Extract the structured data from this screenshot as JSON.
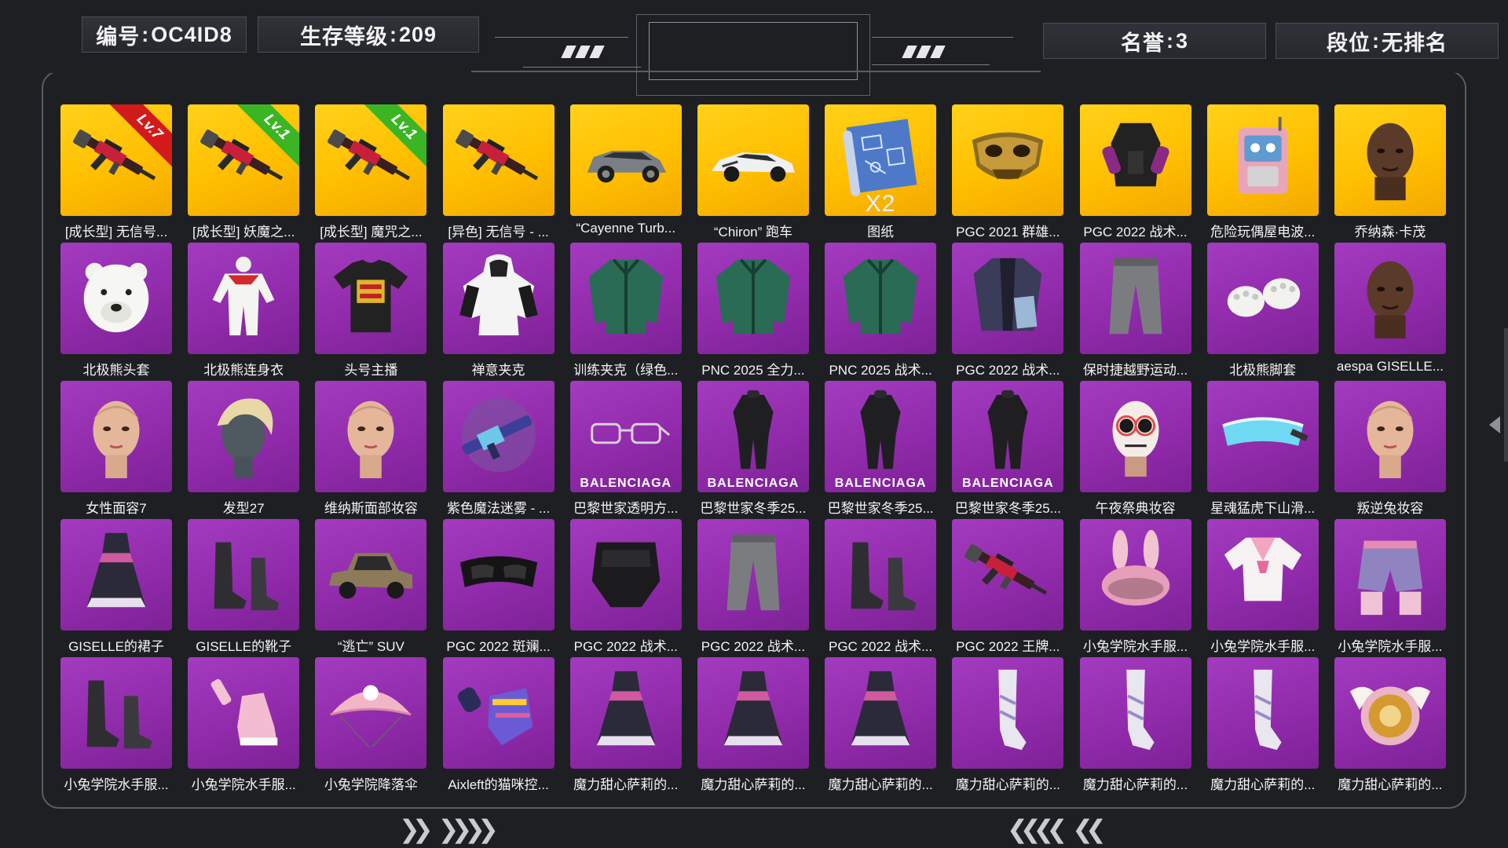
{
  "header": {
    "id_label": "编号",
    "id_value": "OC4ID8",
    "level_label": "生存等级",
    "level_value": "209",
    "honor_label": "名誉",
    "honor_value": "3",
    "rank_label": "段位",
    "rank_value": "无排名"
  },
  "items": [
    {
      "label": "[成长型] 无信号...",
      "bg": "gold",
      "icon": "rifle-icon",
      "ribbon": "Lv.7",
      "ribbon_color": "red"
    },
    {
      "label": "[成长型] 妖魔之...",
      "bg": "gold",
      "icon": "rifle-icon",
      "ribbon": "Lv.1",
      "ribbon_color": "green"
    },
    {
      "label": "[成长型] 魔咒之...",
      "bg": "gold",
      "icon": "rifle-icon",
      "ribbon": "Lv.1",
      "ribbon_color": "green"
    },
    {
      "label": "[异色] 无信号 - ...",
      "bg": "gold",
      "icon": "rifle-icon"
    },
    {
      "label": "“Cayenne Turb...",
      "bg": "gold",
      "icon": "suv-car-icon"
    },
    {
      "label": "“Chiron” 跑车",
      "bg": "gold",
      "icon": "sports-car-icon"
    },
    {
      "label": "图纸",
      "bg": "gold",
      "icon": "blueprint-icon",
      "overlay": "X2"
    },
    {
      "label": "PGC 2021 群雄...",
      "bg": "gold",
      "icon": "gold-mask-icon"
    },
    {
      "label": "PGC 2022 战术...",
      "bg": "gold",
      "icon": "tactical-vest-icon"
    },
    {
      "label": "危险玩偶屋电波...",
      "bg": "gold",
      "icon": "radio-backpack-icon"
    },
    {
      "label": "乔纳森·卡茂",
      "bg": "gold",
      "icon": "character-head-icon"
    },
    {
      "label": "北极熊头套",
      "bg": "purple",
      "icon": "polar-bear-head-icon"
    },
    {
      "label": "北极熊连身衣",
      "bg": "purple",
      "icon": "bear-suit-icon"
    },
    {
      "label": "头号主播",
      "bg": "purple",
      "icon": "tshirt-icon"
    },
    {
      "label": "禅意夹克",
      "bg": "purple",
      "icon": "hoodie-icon"
    },
    {
      "label": "训练夹克（绿色...",
      "bg": "purple",
      "icon": "jacket-icon"
    },
    {
      "label": "PNC 2025 全力...",
      "bg": "purple",
      "icon": "jacket-icon"
    },
    {
      "label": "PNC 2025 战术...",
      "bg": "purple",
      "icon": "jacket-icon"
    },
    {
      "label": "PGC 2022 战术...",
      "bg": "purple",
      "icon": "coat-icon"
    },
    {
      "label": "保时捷越野运动...",
      "bg": "purple",
      "icon": "pants-icon"
    },
    {
      "label": "北极熊脚套",
      "bg": "purple",
      "icon": "paw-slippers-icon"
    },
    {
      "label": "aespa GISELLE...",
      "bg": "purple",
      "icon": "character-head-icon"
    },
    {
      "label": "女性面容7",
      "bg": "purple",
      "icon": "face-icon"
    },
    {
      "label": "发型27",
      "bg": "purple",
      "icon": "hairstyle-icon"
    },
    {
      "label": "维纳斯面部妆容",
      "bg": "purple",
      "icon": "face-icon"
    },
    {
      "label": "紫色魔法迷雾 - ...",
      "bg": "purple",
      "icon": "weapon-skin-icon"
    },
    {
      "label": "巴黎世家透明方...",
      "bg": "purple",
      "icon": "glasses-icon",
      "overlay": "BALENCIAGA"
    },
    {
      "label": "巴黎世家冬季25...",
      "bg": "purple",
      "icon": "outfit-icon",
      "overlay": "BALENCIAGA"
    },
    {
      "label": "巴黎世家冬季25...",
      "bg": "purple",
      "icon": "outfit-icon",
      "overlay": "BALENCIAGA"
    },
    {
      "label": "巴黎世家冬季25...",
      "bg": "purple",
      "icon": "outfit-icon",
      "overlay": "BALENCIAGA"
    },
    {
      "label": "午夜祭典妆容",
      "bg": "purple",
      "icon": "skull-face-icon"
    },
    {
      "label": "星魂猛虎下山滑...",
      "bg": "purple",
      "icon": "ski-goggles-icon"
    },
    {
      "label": "叛逆兔妆容",
      "bg": "purple",
      "icon": "face-icon"
    },
    {
      "label": "GISELLE的裙子",
      "bg": "purple",
      "icon": "dress-icon"
    },
    {
      "label": "GISELLE的靴子",
      "bg": "purple",
      "icon": "boots-icon"
    },
    {
      "label": "“逃亡” SUV",
      "bg": "purple",
      "icon": "classic-car-icon"
    },
    {
      "label": "PGC 2022 斑斓...",
      "bg": "purple",
      "icon": "goggles-icon"
    },
    {
      "label": "PGC 2022 战术...",
      "bg": "purple",
      "icon": "mask-icon"
    },
    {
      "label": "PGC 2022 战术...",
      "bg": "purple",
      "icon": "pants-icon"
    },
    {
      "label": "PGC 2022 战术...",
      "bg": "purple",
      "icon": "boots-icon"
    },
    {
      "label": "PGC 2022 王牌...",
      "bg": "purple",
      "icon": "rifle-icon"
    },
    {
      "label": "小兔学院水手服...",
      "bg": "purple",
      "icon": "bunny-helmet-icon"
    },
    {
      "label": "小兔学院水手服...",
      "bg": "purple",
      "icon": "sailor-top-icon"
    },
    {
      "label": "小兔学院水手服...",
      "bg": "purple",
      "icon": "shorts-icon"
    },
    {
      "label": "小兔学院水手服...",
      "bg": "purple",
      "icon": "boots-icon"
    },
    {
      "label": "小兔学院水手服...",
      "bg": "purple",
      "icon": "sneakers-icon"
    },
    {
      "label": "小兔学院降落伞",
      "bg": "purple",
      "icon": "parachute-icon"
    },
    {
      "label": "Aixleft的猫咪控...",
      "bg": "purple",
      "icon": "gloves-icon"
    },
    {
      "label": "魔力甜心萨莉的...",
      "bg": "purple",
      "icon": "dress-icon"
    },
    {
      "label": "魔力甜心萨莉的...",
      "bg": "purple",
      "icon": "dress-icon"
    },
    {
      "label": "魔力甜心萨莉的...",
      "bg": "purple",
      "icon": "dress-icon"
    },
    {
      "label": "魔力甜心萨莉的...",
      "bg": "purple",
      "icon": "stocking-icon"
    },
    {
      "label": "魔力甜心萨莉的...",
      "bg": "purple",
      "icon": "stocking-icon"
    },
    {
      "label": "魔力甜心萨莉的...",
      "bg": "purple",
      "icon": "stocking-icon"
    },
    {
      "label": "魔力甜心萨莉的...",
      "bg": "purple",
      "icon": "winged-shield-icon"
    }
  ],
  "colors": {
    "gold_tile": "#ffc400",
    "purple_tile": "#9230ad",
    "background": "#1e1f22"
  }
}
